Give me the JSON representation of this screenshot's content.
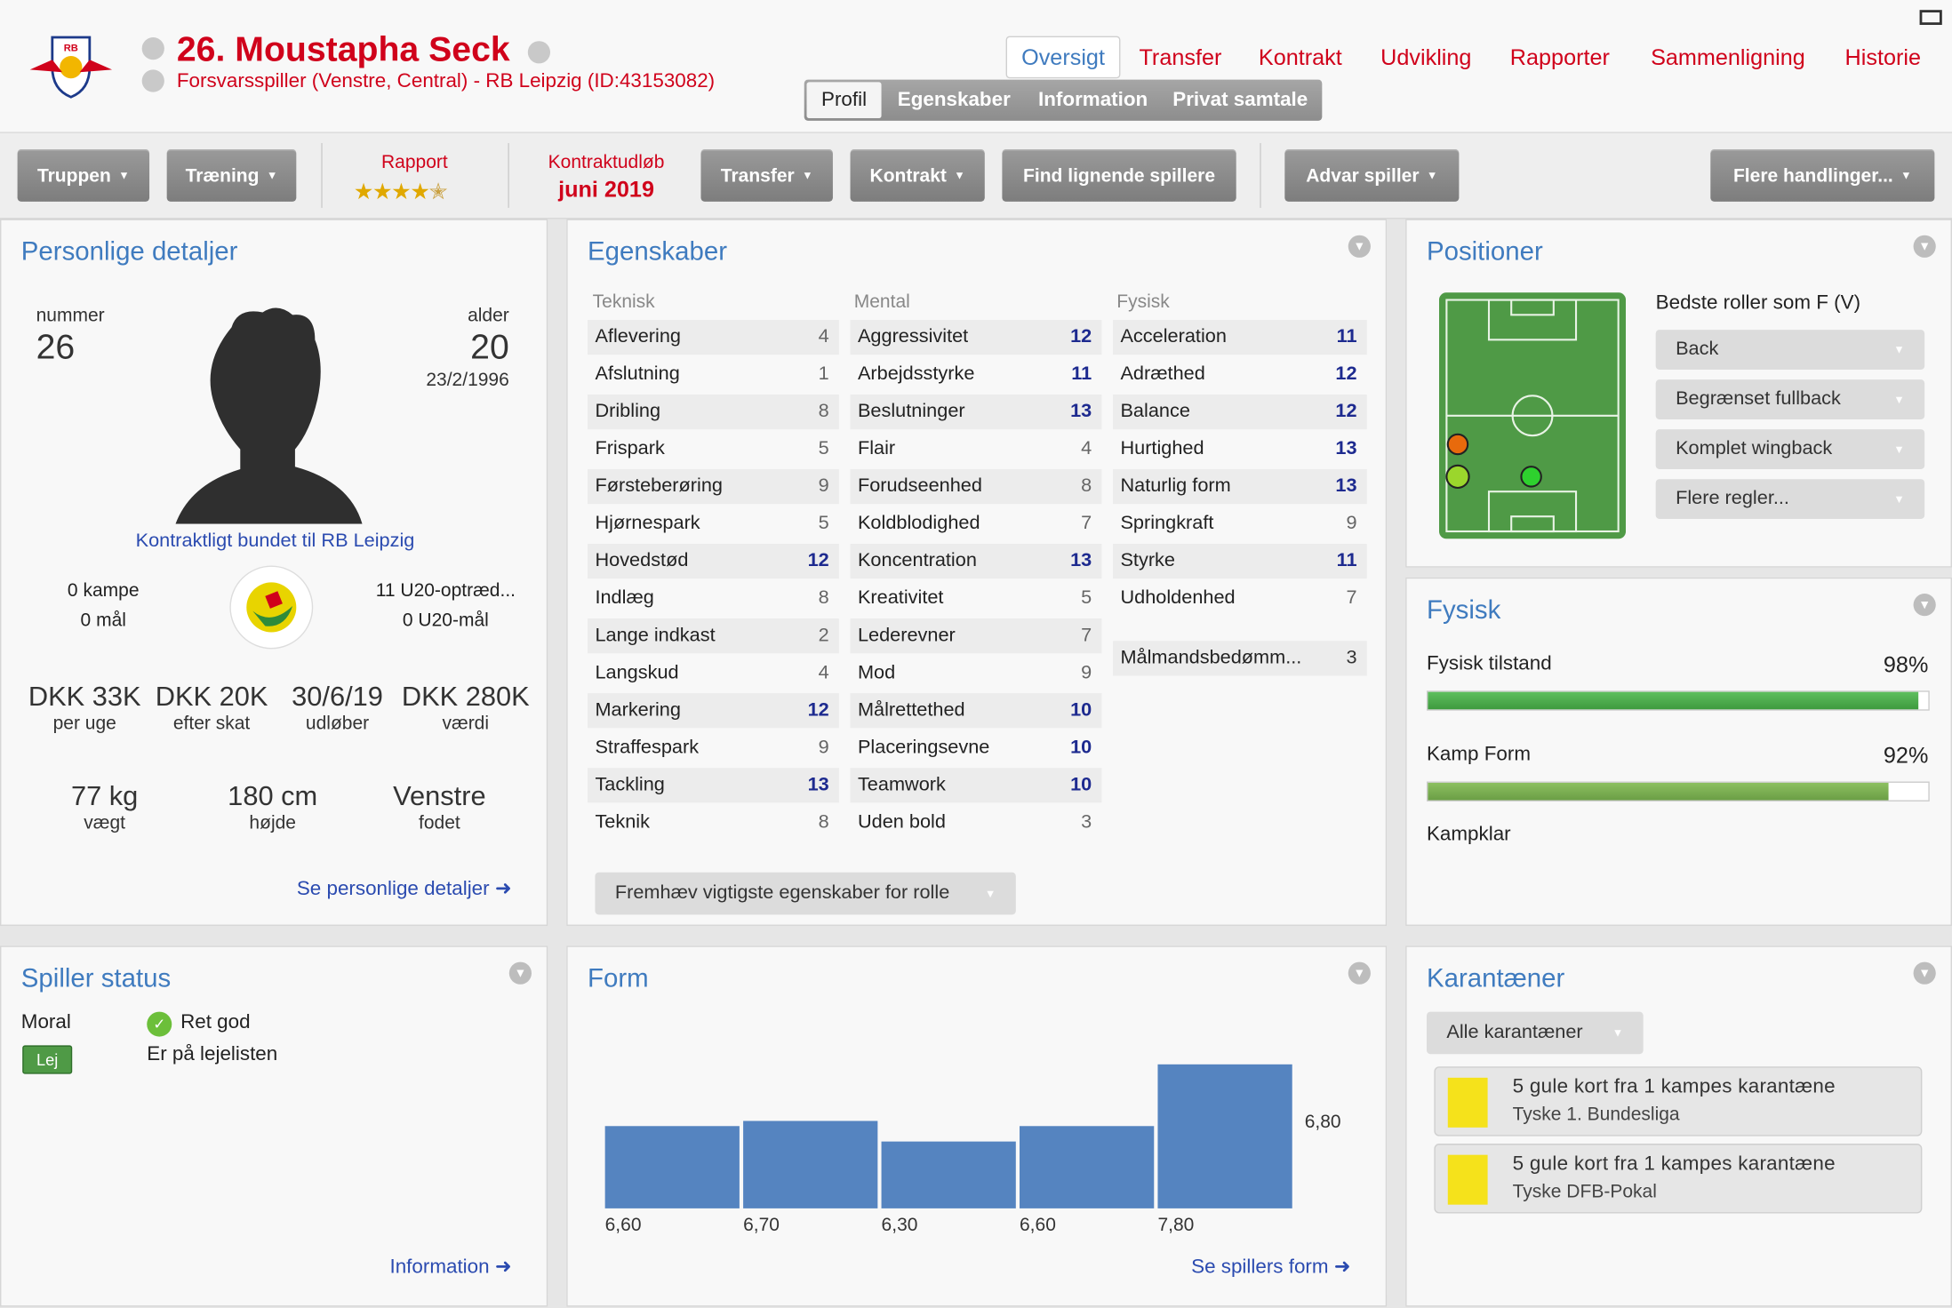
{
  "header": {
    "player_title": "26. Moustapha Seck",
    "player_sub": "Forsvarsspiller (Venstre, Central) - RB Leipzig (ID:43153082)",
    "nav": [
      "Oversigt",
      "Transfer",
      "Kontrakt",
      "Udvikling",
      "Rapporter",
      "Sammenligning",
      "Historie"
    ],
    "subtabs": [
      "Profil",
      "Egenskaber",
      "Information",
      "Privat samtale"
    ]
  },
  "toolbar": {
    "truppen": "Truppen",
    "traening": "Træning",
    "rapport_label": "Rapport",
    "rapport_stars": 4.5,
    "kontrakt_label": "Kontraktudløb",
    "kontrakt_value": "juni 2019",
    "transfer": "Transfer",
    "kontrakt": "Kontrakt",
    "find": "Find lignende spillere",
    "advar": "Advar spiller",
    "flere": "Flere handlinger..."
  },
  "personal": {
    "title": "Personlige detaljer",
    "nummer_label": "nummer",
    "nummer": "26",
    "alder_label": "alder",
    "alder": "20",
    "birth": "23/2/1996",
    "contract_text": "Kontraktligt bundet til RB Leipzig",
    "kampe": "0 kampe",
    "maal": "0 mål",
    "u20_kampe": "11 U20-optræd...",
    "u20_maal": "0 U20-mål",
    "money": [
      {
        "v": "DKK 33K",
        "l": "per uge"
      },
      {
        "v": "DKK 20K",
        "l": "efter skat"
      },
      {
        "v": "30/6/19",
        "l": "udløber"
      },
      {
        "v": "DKK 280K",
        "l": "værdi"
      }
    ],
    "body": [
      {
        "v": "77 kg",
        "l": "vægt"
      },
      {
        "v": "180 cm",
        "l": "højde"
      },
      {
        "v": "Venstre",
        "l": "fodet"
      }
    ],
    "link": "Se personlige detaljer"
  },
  "attributes": {
    "title": "Egenskaber",
    "tech_head": "Teknisk",
    "mental_head": "Mental",
    "phys_head": "Fysisk",
    "technical": [
      {
        "n": "Aflevering",
        "v": "4"
      },
      {
        "n": "Afslutning",
        "v": "1"
      },
      {
        "n": "Dribling",
        "v": "8"
      },
      {
        "n": "Frispark",
        "v": "5"
      },
      {
        "n": "Førsteberøring",
        "v": "9"
      },
      {
        "n": "Hjørnespark",
        "v": "5"
      },
      {
        "n": "Hovedstød",
        "v": "12"
      },
      {
        "n": "Indlæg",
        "v": "8"
      },
      {
        "n": "Lange indkast",
        "v": "2"
      },
      {
        "n": "Langskud",
        "v": "4"
      },
      {
        "n": "Markering",
        "v": "12"
      },
      {
        "n": "Straffespark",
        "v": "9"
      },
      {
        "n": "Tackling",
        "v": "13"
      },
      {
        "n": "Teknik",
        "v": "8"
      }
    ],
    "mental": [
      {
        "n": "Aggressivitet",
        "v": "12"
      },
      {
        "n": "Arbejdsstyrke",
        "v": "11"
      },
      {
        "n": "Beslutninger",
        "v": "13"
      },
      {
        "n": "Flair",
        "v": "4"
      },
      {
        "n": "Forudseenhed",
        "v": "8"
      },
      {
        "n": "Koldblodighed",
        "v": "7"
      },
      {
        "n": "Koncentration",
        "v": "13"
      },
      {
        "n": "Kreativitet",
        "v": "5"
      },
      {
        "n": "Lederevner",
        "v": "7"
      },
      {
        "n": "Mod",
        "v": "9"
      },
      {
        "n": "Målrettethed",
        "v": "10"
      },
      {
        "n": "Placeringsevne",
        "v": "10"
      },
      {
        "n": "Teamwork",
        "v": "10"
      },
      {
        "n": "Uden bold",
        "v": "3"
      }
    ],
    "physical": [
      {
        "n": "Acceleration",
        "v": "11"
      },
      {
        "n": "Adræthed",
        "v": "12"
      },
      {
        "n": "Balance",
        "v": "12"
      },
      {
        "n": "Hurtighed",
        "v": "13"
      },
      {
        "n": "Naturlig form",
        "v": "13"
      },
      {
        "n": "Springkraft",
        "v": "9"
      },
      {
        "n": "Styrke",
        "v": "11"
      },
      {
        "n": "Udholdenhed",
        "v": "7"
      }
    ],
    "gk": {
      "n": "Målmandsbedømm...",
      "v": "3"
    },
    "highlight_btn": "Fremhæv vigtigste egenskaber for rolle"
  },
  "positions": {
    "title": "Positioner",
    "best_label": "Bedste roller som F (V)",
    "roles": [
      "Back",
      "Begrænset fullback",
      "Komplet wingback",
      "Flere regler..."
    ]
  },
  "physical": {
    "title": "Fysisk",
    "cond_label": "Fysisk tilstand",
    "cond_value": "98%",
    "cond_pct": 98,
    "form_label": "Kamp Form",
    "form_value": "92%",
    "form_pct": 92,
    "ready": "Kampklar"
  },
  "status": {
    "title": "Spiller status",
    "moral_label": "Moral",
    "moral_value": "Ret god",
    "loan_badge": "Lej",
    "loan_text": "Er på lejelisten",
    "link": "Information"
  },
  "form": {
    "title": "Form",
    "avg_label": "6,80",
    "link": "Se spillers form"
  },
  "chart_data": {
    "type": "bar",
    "categories": [
      "6,60",
      "6,70",
      "6,30",
      "6,60",
      "7,80"
    ],
    "values": [
      6.6,
      6.7,
      6.3,
      6.6,
      7.8
    ],
    "ylim": [
      5.0,
      8.0
    ]
  },
  "bans": {
    "title": "Karantæner",
    "filter": "Alle karantæner",
    "items": [
      {
        "t": "5 gule kort fra 1 kampes karantæne",
        "s": "Tyske 1. Bundesliga"
      },
      {
        "t": "5 gule kort fra 1 kampes karantæne",
        "s": "Tyske DFB-Pokal"
      }
    ]
  },
  "colors": {
    "accent": "#d0021b",
    "title_blue": "#3f7bbf",
    "bar": "#5584c0",
    "green_bar": "#4caf50"
  }
}
